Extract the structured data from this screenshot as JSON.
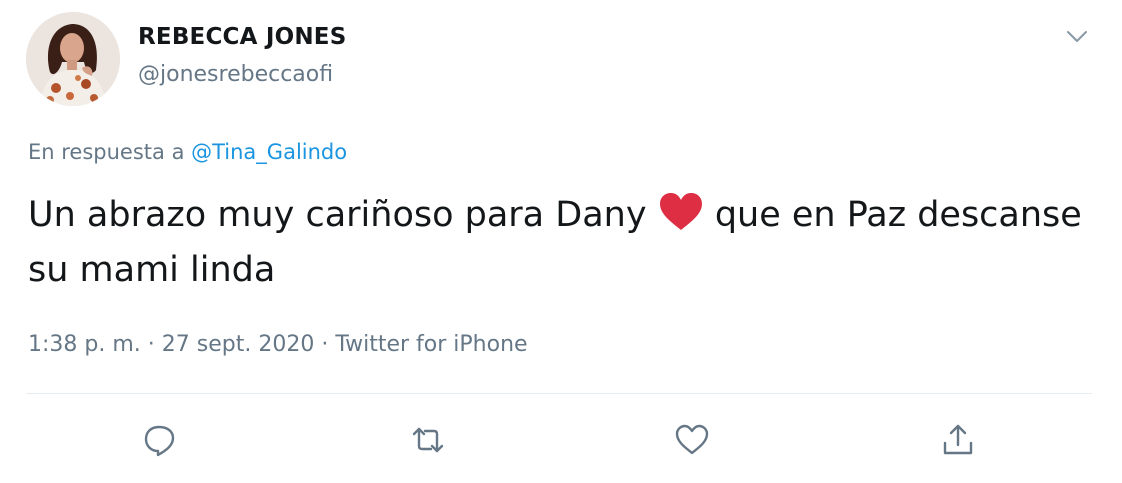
{
  "author": {
    "display_name": "REBECCA JONES",
    "handle": "@jonesrebeccaofi",
    "avatar_icon": "profile-photo"
  },
  "menu": {
    "caret_icon": "chevron-down-icon"
  },
  "reply": {
    "prefix": "En respuesta a ",
    "mention": "@Tina_Galindo"
  },
  "tweet": {
    "text_part1": "Un abrazo muy cariñoso para Dany ",
    "text_part2": " que en Paz descanse su mami linda",
    "emoji": "red-heart"
  },
  "meta": {
    "time": "1:38 p. m.",
    "separator": " · ",
    "date": "27 sept. 2020",
    "source": "Twitter for iPhone"
  },
  "actions": [
    {
      "name": "reply",
      "icon": "comment-icon"
    },
    {
      "name": "retweet",
      "icon": "retweet-icon"
    },
    {
      "name": "like",
      "icon": "heart-icon"
    },
    {
      "name": "share",
      "icon": "share-icon"
    }
  ],
  "colors": {
    "text": "#14171a",
    "secondary": "#657786",
    "link": "#1b95e0",
    "emoji_heart": "#dd2e44",
    "divider": "#e6ecf0"
  }
}
